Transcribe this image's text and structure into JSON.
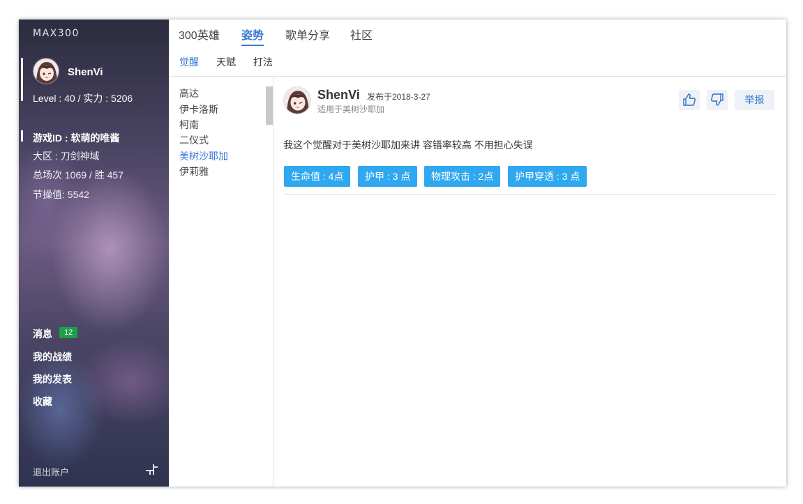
{
  "app": {
    "logo": "MAX300"
  },
  "user": {
    "name": "ShenVi",
    "level_text": "Level : 40 / 实力 : 5206",
    "game_id": "游戏ID : 软萌的唯酱",
    "region": "大区 : 刀剑神域",
    "matches": "总场次 1069 / 胜 457",
    "score": "节操值: 5542"
  },
  "sidebar": {
    "messages_label": "消息",
    "messages_count": "12",
    "records_label": "我的战绩",
    "posts_label": "我的发表",
    "favorites_label": "收藏",
    "logout_label": "退出账户"
  },
  "tabs": [
    {
      "label": "300英雄"
    },
    {
      "label": "姿势",
      "active": true
    },
    {
      "label": "歌单分享"
    },
    {
      "label": "社区"
    }
  ],
  "subtabs": [
    {
      "label": "觉醒",
      "active": true
    },
    {
      "label": "天赋"
    },
    {
      "label": "打法"
    }
  ],
  "heroes": [
    {
      "name": "高达"
    },
    {
      "name": "伊卡洛斯"
    },
    {
      "name": "柯南"
    },
    {
      "name": "二仪式"
    },
    {
      "name": "美树沙耶加",
      "active": true
    },
    {
      "name": "伊莉雅"
    }
  ],
  "post": {
    "author": "ShenVi",
    "date": "发布于2018-3-27",
    "applies_to": "适用于美树沙耶加",
    "report_label": "举报",
    "body": "我这个觉醒对于美树沙耶加来讲 容错率较高 不用担心失误",
    "tags": [
      {
        "label": "生命值 : 4点"
      },
      {
        "label": "护甲 : 3 点"
      },
      {
        "label": "物理攻击 : 2点"
      },
      {
        "label": "护甲穿透 : 3 点"
      }
    ]
  },
  "colors": {
    "accent": "#3a79d6",
    "tag": "#2fa8f0",
    "badge": "#1f9e4a"
  }
}
